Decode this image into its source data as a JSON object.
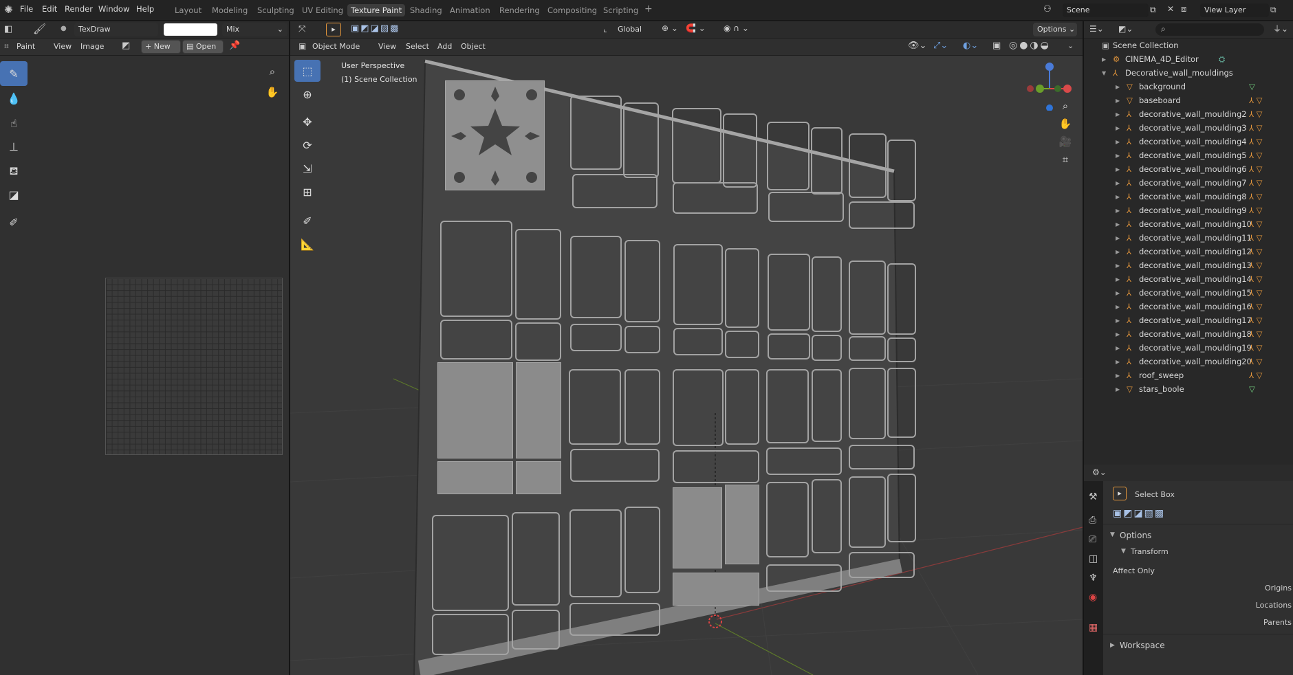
{
  "menu": [
    "File",
    "Edit",
    "Render",
    "Window",
    "Help"
  ],
  "workspaces": [
    "Layout",
    "Modeling",
    "Sculpting",
    "UV Editing",
    "Texture Paint",
    "Shading",
    "Animation",
    "Rendering",
    "Compositing",
    "Scripting"
  ],
  "active_workspace": "Texture Paint",
  "add_workspace": "+",
  "scene": "Scene",
  "view_layer": "View Layer",
  "paint_header": {
    "brush": "TexDraw",
    "blend": "Mix"
  },
  "image_header": {
    "mode": "Paint",
    "view": "View",
    "image": "Image",
    "new": "New",
    "open": "Open"
  },
  "viewport_header": {
    "orientation": "Global",
    "options": "Options",
    "mode": "Object Mode",
    "view": "View",
    "select": "Select",
    "add": "Add",
    "object": "Object"
  },
  "viewport_overlay": {
    "perspective": "User Perspective",
    "collection": "(1) Scene Collection"
  },
  "outliner": {
    "root": "Scene Collection",
    "items": [
      {
        "name": "CINEMA_4D_Editor",
        "depth": 1
      },
      {
        "name": "Decorative_wall_mouldings",
        "depth": 1
      },
      {
        "name": "background",
        "depth": 2
      },
      {
        "name": "baseboard",
        "depth": 2
      },
      {
        "name": "decorative_wall_moulding2",
        "depth": 2
      },
      {
        "name": "decorative_wall_moulding3",
        "depth": 2
      },
      {
        "name": "decorative_wall_moulding4",
        "depth": 2
      },
      {
        "name": "decorative_wall_moulding5",
        "depth": 2
      },
      {
        "name": "decorative_wall_moulding6",
        "depth": 2
      },
      {
        "name": "decorative_wall_moulding7",
        "depth": 2
      },
      {
        "name": "decorative_wall_moulding8",
        "depth": 2
      },
      {
        "name": "decorative_wall_moulding9",
        "depth": 2
      },
      {
        "name": "decorative_wall_moulding10",
        "depth": 2
      },
      {
        "name": "decorative_wall_moulding11",
        "depth": 2
      },
      {
        "name": "decorative_wall_moulding12",
        "depth": 2
      },
      {
        "name": "decorative_wall_moulding13",
        "depth": 2
      },
      {
        "name": "decorative_wall_moulding14",
        "depth": 2
      },
      {
        "name": "decorative_wall_moulding15",
        "depth": 2
      },
      {
        "name": "decorative_wall_moulding16",
        "depth": 2
      },
      {
        "name": "decorative_wall_moulding17",
        "depth": 2
      },
      {
        "name": "decorative_wall_moulding18",
        "depth": 2
      },
      {
        "name": "decorative_wall_moulding19",
        "depth": 2
      },
      {
        "name": "decorative_wall_moulding20",
        "depth": 2
      },
      {
        "name": "roof_sweep",
        "depth": 2
      },
      {
        "name": "stars_boole",
        "depth": 2
      }
    ]
  },
  "properties": {
    "tool": "Select Box",
    "options": "Options",
    "transform": "Transform",
    "affect_only": "Affect Only",
    "origins": "Origins",
    "locations": "Locations",
    "parents": "Parents",
    "workspace": "Workspace"
  },
  "colors": {
    "accent": "#4772b3",
    "bg": "#1d1d1d",
    "panel": "#303030",
    "header": "#2b2b2b",
    "viewport": "#3a3a3a",
    "orange": "#e5973c"
  }
}
